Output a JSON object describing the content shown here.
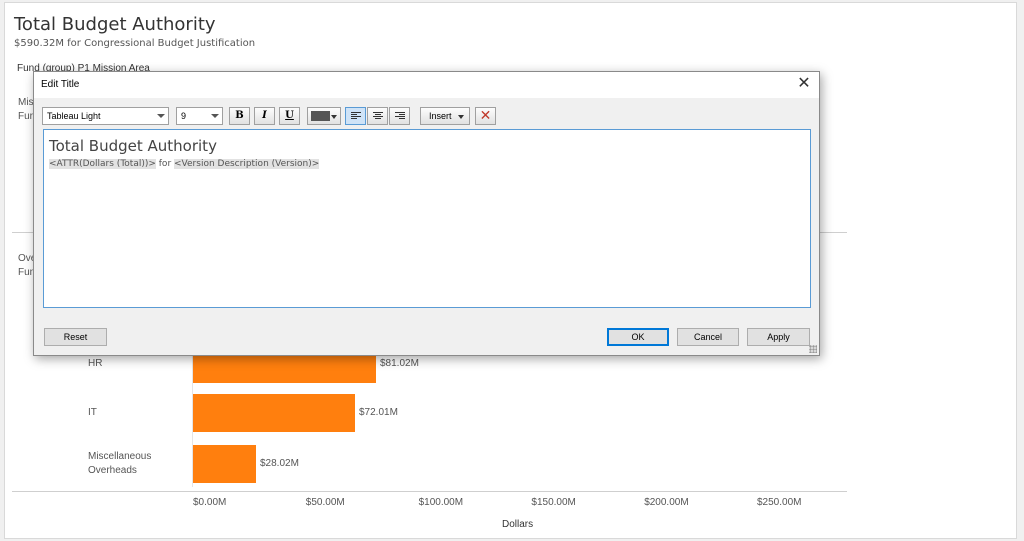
{
  "dashboard": {
    "title": "Total Budget Authority",
    "subtitle": "$590.32M for Congressional Budget Justification",
    "column_header": "Fund (group)  P1 Mission Area",
    "partial_labels": [
      "Mis",
      "Fur",
      "Ove",
      "Fun"
    ]
  },
  "chart_data": {
    "type": "bar",
    "orientation": "horizontal",
    "categories": [
      "HR",
      "IT",
      "Miscellaneous Overheads"
    ],
    "category_lines": [
      [
        "HR"
      ],
      [
        "IT"
      ],
      [
        "Miscellaneous",
        "Overheads"
      ]
    ],
    "values": [
      81.02,
      72.01,
      28.02
    ],
    "value_labels": [
      "$81.02M",
      "$72.01M",
      "$28.02M"
    ],
    "xlabel": "Dollars",
    "xlim": [
      0,
      250
    ],
    "xticks": [
      0,
      50,
      100,
      150,
      200,
      250
    ],
    "xtick_labels": [
      "$0.00M",
      "$50.00M",
      "$100.00M",
      "$150.00M",
      "$200.00M",
      "$250.00M"
    ],
    "bar_color": "#ff7f0e"
  },
  "dialog": {
    "title": "Edit Title",
    "close_icon": "close-icon",
    "font_select": "Tableau Light",
    "size_select": "9",
    "bold_label": "B",
    "italic_label": "I",
    "underline_label": "U",
    "font_color": "#555555",
    "insert_label": "Insert",
    "editor": {
      "title_text": "Total Budget Authority",
      "field1": "<ATTR(Dollars (Total))>",
      "connector": " for ",
      "field2": "<Version Description (Version)>"
    },
    "buttons": {
      "reset": "Reset",
      "ok": "OK",
      "cancel": "Cancel",
      "apply": "Apply"
    }
  }
}
